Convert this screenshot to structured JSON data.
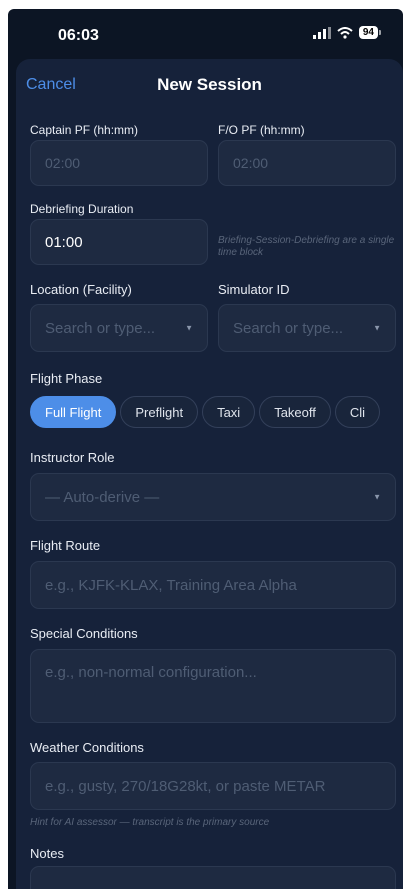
{
  "status": {
    "time": "06:03",
    "battery": "94"
  },
  "header": {
    "cancel": "Cancel",
    "title": "New Session"
  },
  "captain_pf": {
    "label": "Captain PF (hh:mm)",
    "placeholder": "02:00"
  },
  "fo_pf": {
    "label": "F/O PF (hh:mm)",
    "placeholder": "02:00"
  },
  "debriefing": {
    "label": "Debriefing Duration",
    "value": "01:00",
    "hint": "Briefing-Session-Debriefing are a single time block"
  },
  "location": {
    "label": "Location (Facility)",
    "placeholder": "Search or type..."
  },
  "simulator": {
    "label": "Simulator ID",
    "placeholder": "Search or type..."
  },
  "flight_phase": {
    "label": "Flight Phase",
    "chips": [
      "Full Flight",
      "Preflight",
      "Taxi",
      "Takeoff",
      "Cli"
    ],
    "active": "Full Flight"
  },
  "instructor_role": {
    "label": "Instructor Role",
    "value": "— Auto-derive —"
  },
  "flight_route": {
    "label": "Flight Route",
    "placeholder": "e.g., KJFK-KLAX, Training Area Alpha"
  },
  "special_conditions": {
    "label": "Special Conditions",
    "placeholder": "e.g., non-normal configuration..."
  },
  "weather": {
    "label": "Weather Conditions",
    "placeholder": "e.g., gusty, 270/18G28kt, or paste METAR",
    "hint": "Hint for AI assessor — transcript is the primary source"
  },
  "notes": {
    "label": "Notes"
  },
  "colors": {
    "accent": "#4d8ee8",
    "background": "#0c1524",
    "sheet": "#16223a"
  },
  "icons": [
    "cellular-signal-icon",
    "wifi-icon",
    "battery-icon",
    "caret-down-icon"
  ]
}
